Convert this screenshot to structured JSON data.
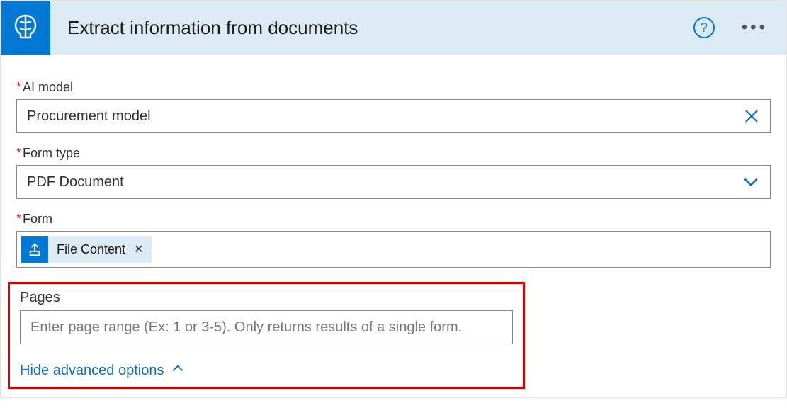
{
  "header": {
    "title": "Extract information from documents"
  },
  "fields": {
    "ai_model": {
      "label": "AI model",
      "required": "*",
      "value": "Procurement model"
    },
    "form_type": {
      "label": "Form type",
      "required": "*",
      "value": "PDF Document"
    },
    "form": {
      "label": "Form",
      "required": "*",
      "pill_label": "File Content"
    },
    "pages": {
      "label": "Pages",
      "placeholder": "Enter page range (Ex: 1 or 3-5). Only returns results of a single form."
    }
  },
  "advanced_link": "Hide advanced options"
}
